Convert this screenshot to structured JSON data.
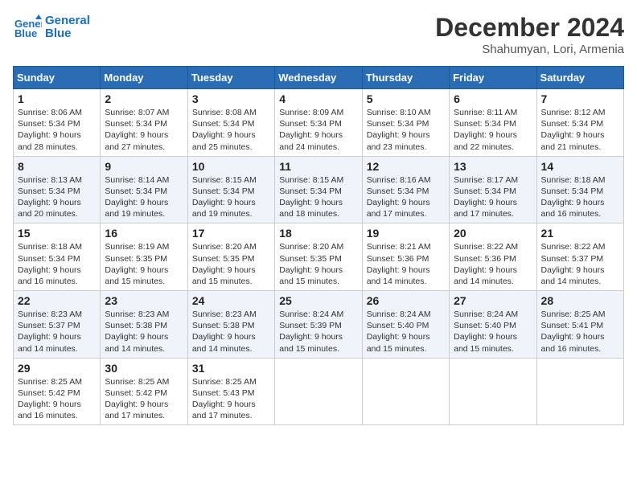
{
  "header": {
    "logo_line1": "General",
    "logo_line2": "Blue",
    "month": "December 2024",
    "location": "Shahumyan, Lori, Armenia"
  },
  "weekdays": [
    "Sunday",
    "Monday",
    "Tuesday",
    "Wednesday",
    "Thursday",
    "Friday",
    "Saturday"
  ],
  "weeks": [
    [
      {
        "day": "1",
        "sunrise": "8:06 AM",
        "sunset": "5:34 PM",
        "daylight": "9 hours and 28 minutes."
      },
      {
        "day": "2",
        "sunrise": "8:07 AM",
        "sunset": "5:34 PM",
        "daylight": "9 hours and 27 minutes."
      },
      {
        "day": "3",
        "sunrise": "8:08 AM",
        "sunset": "5:34 PM",
        "daylight": "9 hours and 25 minutes."
      },
      {
        "day": "4",
        "sunrise": "8:09 AM",
        "sunset": "5:34 PM",
        "daylight": "9 hours and 24 minutes."
      },
      {
        "day": "5",
        "sunrise": "8:10 AM",
        "sunset": "5:34 PM",
        "daylight": "9 hours and 23 minutes."
      },
      {
        "day": "6",
        "sunrise": "8:11 AM",
        "sunset": "5:34 PM",
        "daylight": "9 hours and 22 minutes."
      },
      {
        "day": "7",
        "sunrise": "8:12 AM",
        "sunset": "5:34 PM",
        "daylight": "9 hours and 21 minutes."
      }
    ],
    [
      {
        "day": "8",
        "sunrise": "8:13 AM",
        "sunset": "5:34 PM",
        "daylight": "9 hours and 20 minutes."
      },
      {
        "day": "9",
        "sunrise": "8:14 AM",
        "sunset": "5:34 PM",
        "daylight": "9 hours and 19 minutes."
      },
      {
        "day": "10",
        "sunrise": "8:15 AM",
        "sunset": "5:34 PM",
        "daylight": "9 hours and 19 minutes."
      },
      {
        "day": "11",
        "sunrise": "8:15 AM",
        "sunset": "5:34 PM",
        "daylight": "9 hours and 18 minutes."
      },
      {
        "day": "12",
        "sunrise": "8:16 AM",
        "sunset": "5:34 PM",
        "daylight": "9 hours and 17 minutes."
      },
      {
        "day": "13",
        "sunrise": "8:17 AM",
        "sunset": "5:34 PM",
        "daylight": "9 hours and 17 minutes."
      },
      {
        "day": "14",
        "sunrise": "8:18 AM",
        "sunset": "5:34 PM",
        "daylight": "9 hours and 16 minutes."
      }
    ],
    [
      {
        "day": "15",
        "sunrise": "8:18 AM",
        "sunset": "5:34 PM",
        "daylight": "9 hours and 16 minutes."
      },
      {
        "day": "16",
        "sunrise": "8:19 AM",
        "sunset": "5:35 PM",
        "daylight": "9 hours and 15 minutes."
      },
      {
        "day": "17",
        "sunrise": "8:20 AM",
        "sunset": "5:35 PM",
        "daylight": "9 hours and 15 minutes."
      },
      {
        "day": "18",
        "sunrise": "8:20 AM",
        "sunset": "5:35 PM",
        "daylight": "9 hours and 15 minutes."
      },
      {
        "day": "19",
        "sunrise": "8:21 AM",
        "sunset": "5:36 PM",
        "daylight": "9 hours and 14 minutes."
      },
      {
        "day": "20",
        "sunrise": "8:22 AM",
        "sunset": "5:36 PM",
        "daylight": "9 hours and 14 minutes."
      },
      {
        "day": "21",
        "sunrise": "8:22 AM",
        "sunset": "5:37 PM",
        "daylight": "9 hours and 14 minutes."
      }
    ],
    [
      {
        "day": "22",
        "sunrise": "8:23 AM",
        "sunset": "5:37 PM",
        "daylight": "9 hours and 14 minutes."
      },
      {
        "day": "23",
        "sunrise": "8:23 AM",
        "sunset": "5:38 PM",
        "daylight": "9 hours and 14 minutes."
      },
      {
        "day": "24",
        "sunrise": "8:23 AM",
        "sunset": "5:38 PM",
        "daylight": "9 hours and 14 minutes."
      },
      {
        "day": "25",
        "sunrise": "8:24 AM",
        "sunset": "5:39 PM",
        "daylight": "9 hours and 15 minutes."
      },
      {
        "day": "26",
        "sunrise": "8:24 AM",
        "sunset": "5:40 PM",
        "daylight": "9 hours and 15 minutes."
      },
      {
        "day": "27",
        "sunrise": "8:24 AM",
        "sunset": "5:40 PM",
        "daylight": "9 hours and 15 minutes."
      },
      {
        "day": "28",
        "sunrise": "8:25 AM",
        "sunset": "5:41 PM",
        "daylight": "9 hours and 16 minutes."
      }
    ],
    [
      {
        "day": "29",
        "sunrise": "8:25 AM",
        "sunset": "5:42 PM",
        "daylight": "9 hours and 16 minutes."
      },
      {
        "day": "30",
        "sunrise": "8:25 AM",
        "sunset": "5:42 PM",
        "daylight": "9 hours and 17 minutes."
      },
      {
        "day": "31",
        "sunrise": "8:25 AM",
        "sunset": "5:43 PM",
        "daylight": "9 hours and 17 minutes."
      },
      null,
      null,
      null,
      null
    ]
  ]
}
